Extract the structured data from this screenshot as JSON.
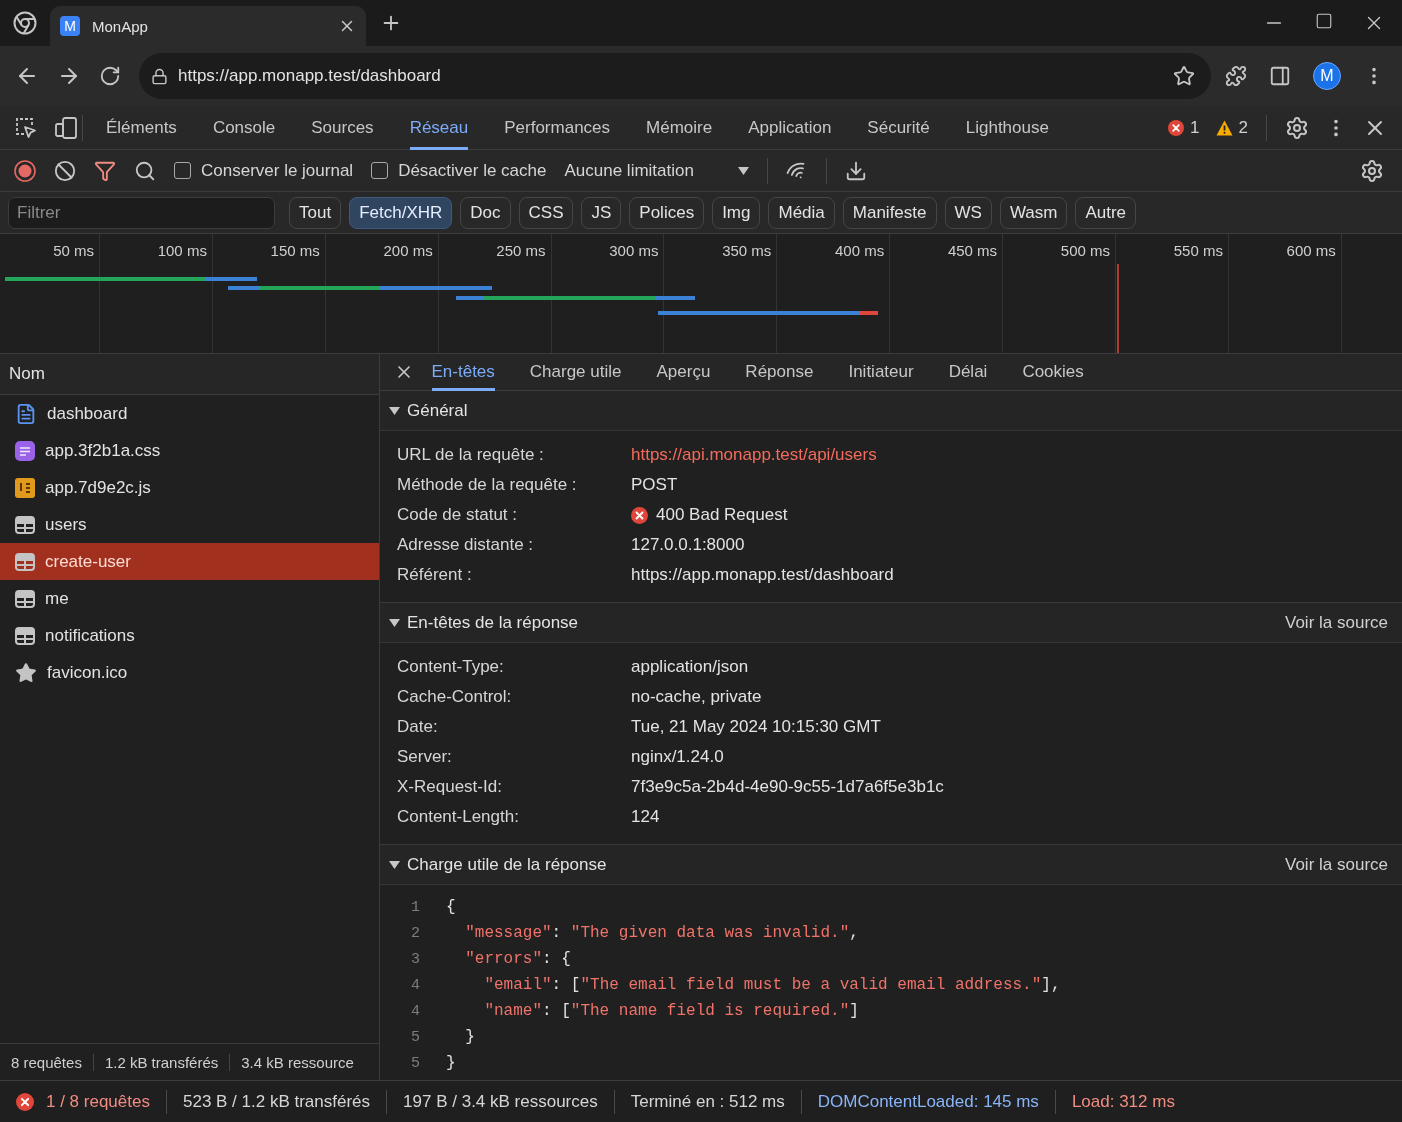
{
  "browser": {
    "tab": {
      "favicon": "M",
      "title": "MonApp"
    },
    "url": "https://app.monapp.test/dashboard",
    "avatar": "M"
  },
  "devtools": {
    "tabs": [
      {
        "label": "Éléments",
        "selected": false
      },
      {
        "label": "Console",
        "selected": false
      },
      {
        "label": "Sources",
        "selected": false
      },
      {
        "label": "Réseau",
        "selected": true
      },
      {
        "label": "Performances",
        "selected": false
      },
      {
        "label": "Mémoire",
        "selected": false
      },
      {
        "label": "Application",
        "selected": false
      },
      {
        "label": "Sécurité",
        "selected": false
      },
      {
        "label": "Lighthouse",
        "selected": false
      }
    ],
    "errors": "1",
    "warnings": "2"
  },
  "network_toolbar": {
    "recording": true,
    "filter_active": true,
    "checkboxes": [
      {
        "label": "Conserver le journal",
        "checked": false
      },
      {
        "label": "Désactiver le cache",
        "checked": false
      }
    ],
    "throttling": "Aucune limitation"
  },
  "filter": {
    "placeholder": "Filtrer",
    "types": [
      {
        "label": "Tout",
        "selected": false
      },
      {
        "label": "Fetch/XHR",
        "selected": true
      },
      {
        "label": "Doc",
        "selected": false
      },
      {
        "label": "CSS",
        "selected": false
      },
      {
        "label": "JS",
        "selected": false
      },
      {
        "label": "Polices",
        "selected": false
      },
      {
        "label": "Img",
        "selected": false
      },
      {
        "label": "Média",
        "selected": false
      },
      {
        "label": "Manifeste",
        "selected": false
      },
      {
        "label": "WS",
        "selected": false
      },
      {
        "label": "Wasm",
        "selected": false
      },
      {
        "label": "Autre",
        "selected": false
      }
    ]
  },
  "timeline": {
    "ticks": [
      "50 ms",
      "100 ms",
      "150 ms",
      "200 ms",
      "250 ms",
      "300 ms",
      "350 ms",
      "400 ms",
      "450 ms",
      "500 ms",
      "550 ms",
      "600 ms"
    ]
  },
  "requests": {
    "column": "Nom",
    "rows": [
      {
        "name": "dashboard",
        "kind": "document",
        "selected": false
      },
      {
        "name": "app.3f2b1a.css",
        "kind": "stylesheet",
        "selected": false
      },
      {
        "name": "app.7d9e2c.js",
        "kind": "script",
        "selected": false
      },
      {
        "name": "users",
        "kind": "fetch",
        "selected": false
      },
      {
        "name": "create-user",
        "kind": "fetch",
        "selected": true
      },
      {
        "name": "me",
        "kind": "fetch",
        "selected": false
      },
      {
        "name": "notifications",
        "kind": "fetch",
        "selected": false
      },
      {
        "name": "favicon.ico",
        "kind": "image",
        "selected": false
      }
    ],
    "summary": [
      "8 requêtes",
      "1.2 kB transférés",
      "3.4 kB ressource"
    ]
  },
  "details": {
    "tabs": [
      {
        "label": "En-têtes",
        "selected": true
      },
      {
        "label": "Charge utile",
        "selected": false
      },
      {
        "label": "Aperçu",
        "selected": false
      },
      {
        "label": "Réponse",
        "selected": false
      },
      {
        "label": "Initiateur",
        "selected": false
      },
      {
        "label": "Délai",
        "selected": false
      },
      {
        "label": "Cookies",
        "selected": false
      }
    ],
    "sections": [
      {
        "kind": "headers",
        "title": "Général",
        "expanded": true,
        "rows": [
          {
            "label": "URL de la requête :",
            "value": "https://api.monapp.test/api/users",
            "kind": "link"
          },
          {
            "label": "Méthode de la requête :",
            "value": "POST",
            "kind": "text"
          },
          {
            "label": "Code de statut :",
            "value": "400 Bad Request",
            "kind": "status"
          },
          {
            "label": "Adresse distante :",
            "value": "127.0.0.1:8000",
            "kind": "text"
          },
          {
            "label": "Référent :",
            "value": "https://app.monapp.test/dashboard",
            "kind": "text"
          }
        ]
      },
      {
        "kind": "headers",
        "title": "En-têtes de la réponse",
        "expanded": true,
        "action": "Voir la source",
        "rows": [
          {
            "label": "Content-Type:",
            "value": "application/json",
            "kind": "text"
          },
          {
            "label": "Cache-Control:",
            "value": "no-cache, private",
            "kind": "text"
          },
          {
            "label": "Date:",
            "value": "Tue, 21 May 2024 10:15:30 GMT",
            "kind": "text"
          },
          {
            "label": "Server:",
            "value": "nginx/1.24.0",
            "kind": "text"
          },
          {
            "label": "X-Request-Id:",
            "value": "7f3e9c5a-2b4d-4e90-9c55-1d7a6f5e3b1c",
            "kind": "text"
          },
          {
            "label": "Content-Length:",
            "value": "124",
            "kind": "text"
          }
        ]
      },
      {
        "kind": "code",
        "title": "Charge utile de la réponse",
        "expanded": true,
        "action": "Voir la source",
        "lines": [
          {
            "number": "1",
            "tokens": [
              {
                "kind": "punct",
                "text": "{"
              }
            ],
            "children": [
              {
                "number": "2",
                "tokens": [
                  {
                    "kind": "string",
                    "text": "\"message\""
                  },
                  {
                    "kind": "punct",
                    "text": ": "
                  },
                  {
                    "kind": "string",
                    "text": "\"The given data was invalid.\""
                  },
                  {
                    "kind": "punct",
                    "text": ","
                  }
                ]
              },
              {
                "number": "3",
                "tokens": [
                  {
                    "kind": "string",
                    "text": "\"errors\""
                  },
                  {
                    "kind": "punct",
                    "text": ": {"
                  }
                ],
                "children": [
                  {
                    "number": "4",
                    "tokens": [
                      {
                        "kind": "string",
                        "text": "\"email\""
                      },
                      {
                        "kind": "punct",
                        "text": ": ["
                      },
                      {
                        "kind": "string",
                        "text": "\"The email field must be a valid email address.\""
                      },
                      {
                        "kind": "punct",
                        "text": "],"
                      }
                    ]
                  },
                  {
                    "number": "4",
                    "tokens": [
                      {
                        "kind": "string",
                        "text": "\"name\""
                      },
                      {
                        "kind": "punct",
                        "text": ": ["
                      },
                      {
                        "kind": "string",
                        "text": "\"The name field is required.\""
                      },
                      {
                        "kind": "punct",
                        "text": "]"
                      }
                    ]
                  }
                ]
              },
              {
                "number": "5",
                "tokens": [
                  {
                    "kind": "punct",
                    "text": "}"
                  }
                ]
              }
            ]
          },
          {
            "number": "5",
            "tokens": [
              {
                "kind": "punct",
                "text": "}"
              }
            ]
          }
        ]
      }
    ]
  },
  "status_bar": [
    {
      "kind": "errors",
      "text": "1 / 8 requêtes"
    },
    {
      "kind": "plain",
      "text": "523 B / 1.2 kB transférés"
    },
    {
      "kind": "plain",
      "text": "197 B / 3.4 kB ressources"
    },
    {
      "kind": "plain",
      "text": "Terminé en : 512 ms"
    },
    {
      "kind": "dcl",
      "text": "DOMContentLoaded: 145 ms"
    },
    {
      "kind": "load",
      "text": "Load: 312 ms"
    }
  ]
}
